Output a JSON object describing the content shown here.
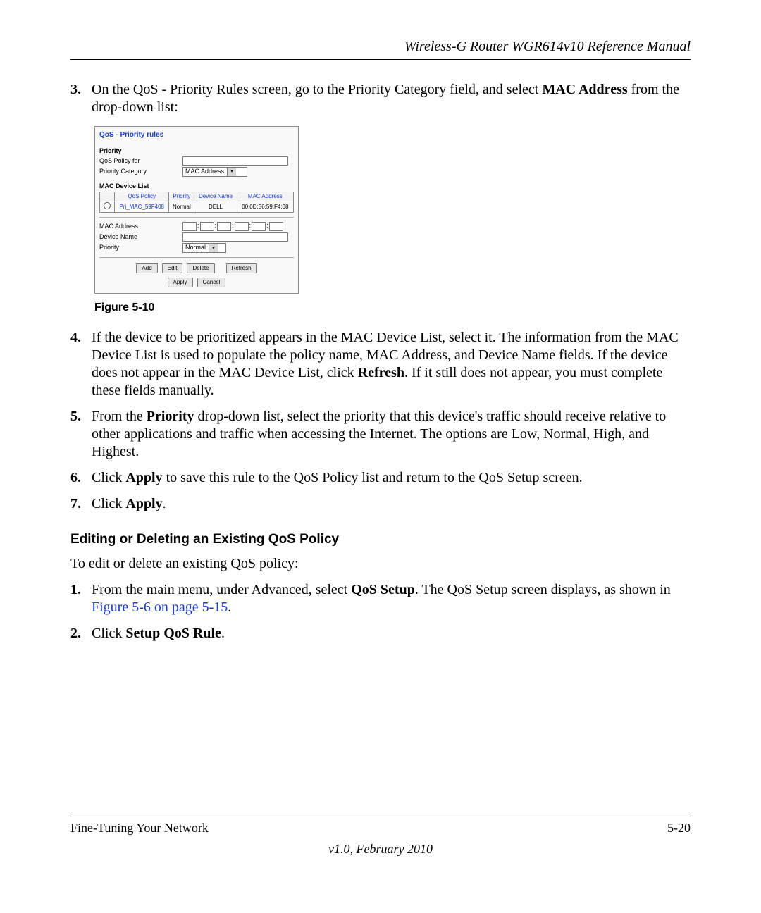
{
  "header": {
    "title": "Wireless-G Router WGR614v10 Reference Manual"
  },
  "step3": {
    "num": "3.",
    "pre": "On the QoS - Priority Rules screen, go to the Priority Category field, and select ",
    "bold": "MAC Address",
    "post": " from the drop-down list:"
  },
  "figure": {
    "title": "QoS - Priority rules",
    "priority_section": "Priority",
    "qos_policy_for": "QoS Policy for",
    "priority_category_label": "Priority Category",
    "priority_category_value": "MAC Address",
    "mac_device_list_label": "MAC Device List",
    "table_headers": {
      "radio": "",
      "qos_policy": "QoS Policy",
      "priority": "Priority",
      "device_name": "Device Name",
      "mac": "MAC Address"
    },
    "table_row": {
      "qos_policy": "Pri_MAC_59F408",
      "priority": "Normal",
      "device_name": "DELL",
      "mac": "00:0D:56:59:F4:08"
    },
    "mac_address_label": "MAC Address",
    "device_name_label": "Device Name",
    "priority_label": "Priority",
    "priority_value": "Normal",
    "buttons": {
      "add": "Add",
      "edit": "Edit",
      "delete": "Delete",
      "refresh": "Refresh",
      "apply": "Apply",
      "cancel": "Cancel"
    },
    "caption": "Figure 5-10"
  },
  "step4": {
    "num": "4.",
    "p1": "If the device to be prioritized appears in the MAC Device List, select it. The information from the MAC Device List is used to populate the policy name, MAC Address, and Device Name fields. If the device does not appear in the MAC Device List, click ",
    "b": "Refresh",
    "p2": ". If it still does not appear, you must complete these fields manually."
  },
  "step5": {
    "num": "5.",
    "p1": "From the ",
    "b": "Priority",
    "p2": " drop-down list, select the priority that this device's traffic should receive relative to other applications and traffic when accessing the Internet. The options are Low, Normal, High, and Highest."
  },
  "step6": {
    "num": "6.",
    "p1": "Click ",
    "b": "Apply",
    "p2": " to save this rule to the QoS Policy list and return to the QoS Setup screen."
  },
  "step7": {
    "num": "7.",
    "p1": "Click ",
    "b": "Apply",
    "p2": "."
  },
  "subheading": "Editing or Deleting an Existing QoS Policy",
  "intro": "To edit or delete an existing QoS policy:",
  "edit1": {
    "num": "1.",
    "p1": "From the main menu, under Advanced, select ",
    "b": "QoS Setup",
    "p2": ". The QoS Setup screen displays, as shown in ",
    "link": "Figure 5-6 on page 5-15",
    "p3": "."
  },
  "edit2": {
    "num": "2.",
    "p1": "Click ",
    "b": "Setup QoS Rule",
    "p2": "."
  },
  "footer": {
    "left": "Fine-Tuning Your Network",
    "right": "5-20",
    "version": "v1.0, February 2010"
  }
}
